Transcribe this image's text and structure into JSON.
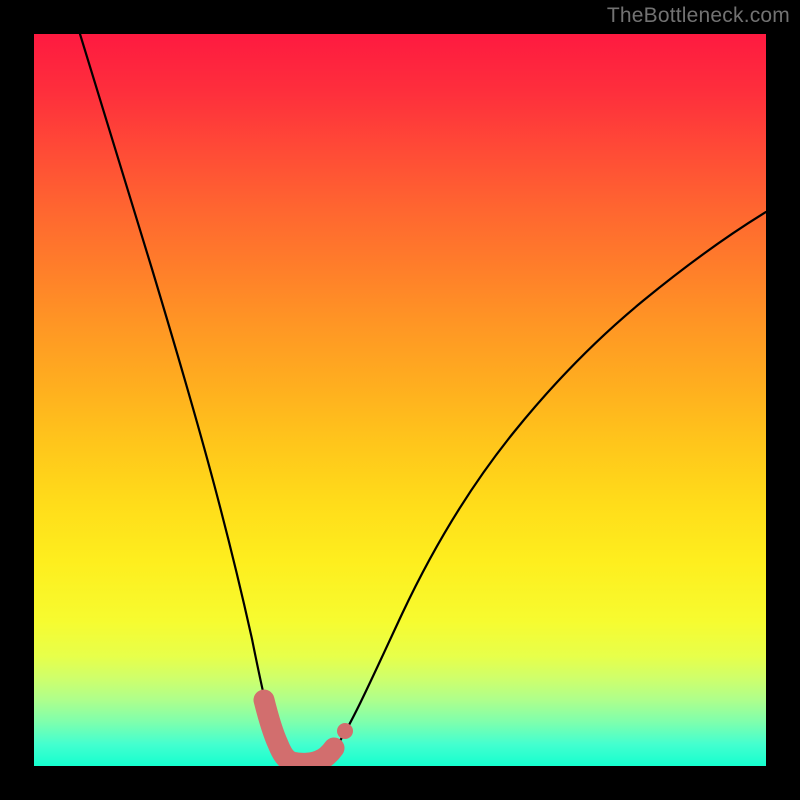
{
  "watermark": "TheBottleneck.com",
  "chart_data": {
    "type": "line",
    "title": "",
    "xlabel": "",
    "ylabel": "",
    "xlim": [
      0,
      100
    ],
    "ylim": [
      0,
      100
    ],
    "grid": false,
    "series": [
      {
        "name": "curve",
        "x": [
          10,
          12,
          14,
          16,
          18,
          20,
          22,
          24,
          26,
          28,
          30,
          31,
          32,
          33,
          34,
          35,
          36,
          37,
          38,
          40,
          44,
          48,
          52,
          56,
          60,
          66,
          72,
          80,
          90,
          100
        ],
        "y": [
          100,
          93,
          85,
          77,
          69,
          61,
          52,
          43,
          34,
          25,
          16,
          12,
          8,
          5,
          3,
          2,
          2,
          3,
          5,
          9,
          18,
          27,
          35,
          42,
          48,
          55,
          61,
          67,
          74,
          79
        ]
      }
    ],
    "highlight_segment": {
      "name": "bottom-highlight",
      "x_range": [
        30.5,
        38.5
      ],
      "dot_x": 39.5,
      "color": "#d26e6e"
    },
    "background_gradient": {
      "top": "#fe1a40",
      "middle": "#ffdc1a",
      "bottom": "#15ffcf"
    }
  }
}
